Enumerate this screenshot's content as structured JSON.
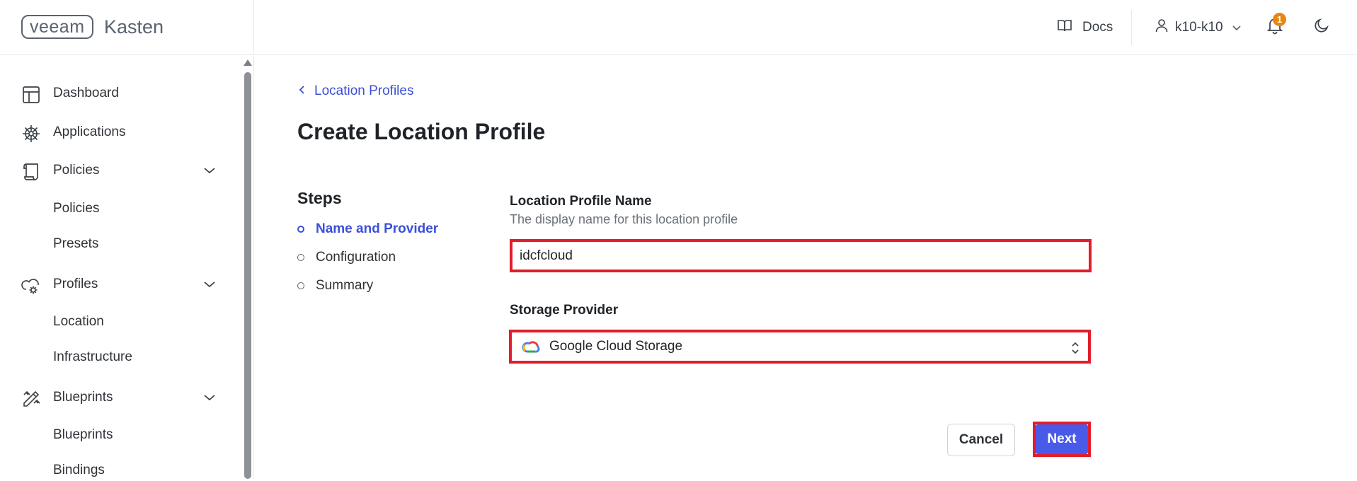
{
  "header": {
    "logo_left": "veeam",
    "logo_right": "Kasten",
    "docs_label": "Docs",
    "user_label": "k10-k10",
    "notification_count": "1"
  },
  "sidebar": {
    "items": [
      {
        "label": "Dashboard",
        "icon": "dashboard-icon"
      },
      {
        "label": "Applications",
        "icon": "helm-icon"
      },
      {
        "label": "Policies",
        "icon": "scroll-icon",
        "expanded": true,
        "children": [
          "Policies",
          "Presets"
        ]
      },
      {
        "label": "Profiles",
        "icon": "cloud-gear-icon",
        "expanded": true,
        "children": [
          "Location",
          "Infrastructure"
        ]
      },
      {
        "label": "Blueprints",
        "icon": "pencil-ruler-icon",
        "expanded": true,
        "children": [
          "Blueprints",
          "Bindings"
        ]
      }
    ]
  },
  "main": {
    "breadcrumb": "Location Profiles",
    "title": "Create Location Profile",
    "steps_title": "Steps",
    "steps": [
      {
        "label": "Name and Provider",
        "active": true
      },
      {
        "label": "Configuration",
        "active": false
      },
      {
        "label": "Summary",
        "active": false
      }
    ],
    "name_field": {
      "label": "Location Profile Name",
      "help": "The display name for this location profile",
      "value": "idcfcloud"
    },
    "provider_field": {
      "label": "Storage Provider",
      "value": "Google Cloud Storage"
    },
    "cancel_label": "Cancel",
    "next_label": "Next"
  },
  "colors": {
    "accent": "#3b4fd9",
    "button_primary": "#4a5ae8",
    "highlight_border": "#e11d2c",
    "badge": "#e8870e"
  }
}
